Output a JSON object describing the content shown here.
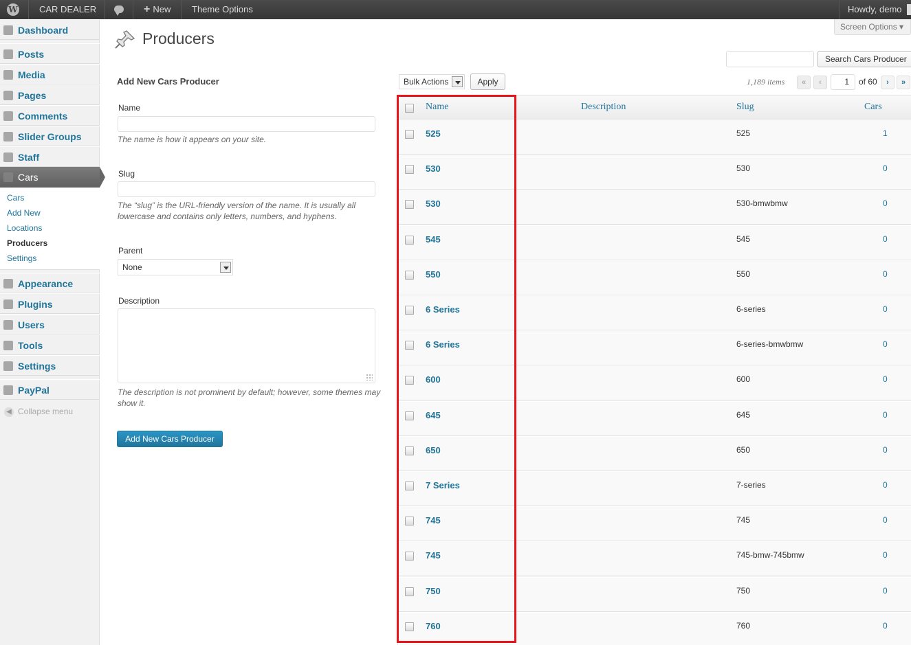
{
  "adminbar": {
    "site_name": "CAR DEALER",
    "new_label": "New",
    "theme_options": "Theme Options",
    "howdy": "Howdy, demo"
  },
  "sidebar": {
    "items": [
      {
        "label": "Dashboard",
        "icon": "dashboard-icon"
      },
      {
        "label": "Posts",
        "icon": "pushpin-icon"
      },
      {
        "label": "Media",
        "icon": "media-icon"
      },
      {
        "label": "Pages",
        "icon": "pages-icon"
      },
      {
        "label": "Comments",
        "icon": "comment-icon"
      },
      {
        "label": "Slider Groups",
        "icon": "slider-icon"
      },
      {
        "label": "Staff",
        "icon": "staff-icon"
      },
      {
        "label": "Cars",
        "icon": "car-icon"
      },
      {
        "label": "Appearance",
        "icon": "appearance-icon"
      },
      {
        "label": "Plugins",
        "icon": "plugins-icon"
      },
      {
        "label": "Users",
        "icon": "users-icon"
      },
      {
        "label": "Tools",
        "icon": "tools-icon"
      },
      {
        "label": "Settings",
        "icon": "settings-icon"
      },
      {
        "label": "PayPal",
        "icon": "paypal-icon"
      }
    ],
    "submenu": [
      "Cars",
      "Add New",
      "Locations",
      "Producers",
      "Settings"
    ],
    "collapse": "Collapse menu"
  },
  "header": {
    "title": "Producers",
    "screen_options": "Screen Options ▾"
  },
  "search": {
    "value": "",
    "button": "Search Cars Producer"
  },
  "form": {
    "heading": "Add New Cars Producer",
    "name_label": "Name",
    "name_hint": "The name is how it appears on your site.",
    "slug_label": "Slug",
    "slug_hint": "The “slug” is the URL-friendly version of the name. It is usually all lowercase and contains only letters, numbers, and hyphens.",
    "parent_label": "Parent",
    "parent_value": "None",
    "description_label": "Description",
    "description_hint": "The description is not prominent by default; however, some themes may show it.",
    "submit": "Add New Cars Producer"
  },
  "tablenav": {
    "bulk_actions": "Bulk Actions",
    "apply": "Apply",
    "items_count": "1,189 items",
    "first": "«",
    "prev": "‹",
    "current_page": "1",
    "of_pages": "of 60",
    "next": "›",
    "last": "»"
  },
  "table": {
    "columns": [
      "Name",
      "Description",
      "Slug",
      "Cars"
    ],
    "rows": [
      {
        "name": "525",
        "description": "",
        "slug": "525",
        "cars": "1"
      },
      {
        "name": "530",
        "description": "",
        "slug": "530",
        "cars": "0"
      },
      {
        "name": "530",
        "description": "",
        "slug": "530-bmwbmw",
        "cars": "0"
      },
      {
        "name": "545",
        "description": "",
        "slug": "545",
        "cars": "0"
      },
      {
        "name": "550",
        "description": "",
        "slug": "550",
        "cars": "0"
      },
      {
        "name": "6 Series",
        "description": "",
        "slug": "6-series",
        "cars": "0"
      },
      {
        "name": "6 Series",
        "description": "",
        "slug": "6-series-bmwbmw",
        "cars": "0"
      },
      {
        "name": "600",
        "description": "",
        "slug": "600",
        "cars": "0"
      },
      {
        "name": "645",
        "description": "",
        "slug": "645",
        "cars": "0"
      },
      {
        "name": "650",
        "description": "",
        "slug": "650",
        "cars": "0"
      },
      {
        "name": "7 Series",
        "description": "",
        "slug": "7-series",
        "cars": "0"
      },
      {
        "name": "745",
        "description": "",
        "slug": "745",
        "cars": "0"
      },
      {
        "name": "745",
        "description": "",
        "slug": "745-bmw-745bmw",
        "cars": "0"
      },
      {
        "name": "750",
        "description": "",
        "slug": "750",
        "cars": "0"
      },
      {
        "name": "760",
        "description": "",
        "slug": "760",
        "cars": "0"
      }
    ]
  },
  "colors": {
    "link": "#21759b",
    "highlight": "#e8141a",
    "adminbar": "#464646"
  }
}
